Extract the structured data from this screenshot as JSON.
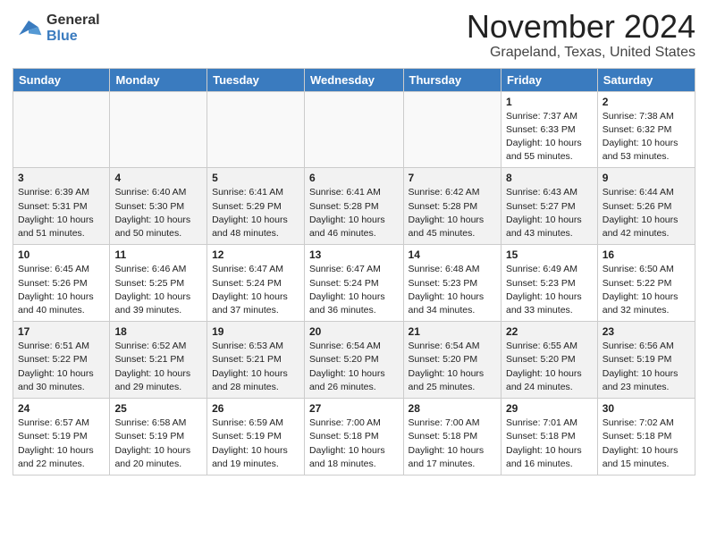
{
  "logo": {
    "general": "General",
    "blue": "Blue"
  },
  "title": "November 2024",
  "location": "Grapeland, Texas, United States",
  "weekdays": [
    "Sunday",
    "Monday",
    "Tuesday",
    "Wednesday",
    "Thursday",
    "Friday",
    "Saturday"
  ],
  "weeks": [
    [
      {
        "day": "",
        "info": ""
      },
      {
        "day": "",
        "info": ""
      },
      {
        "day": "",
        "info": ""
      },
      {
        "day": "",
        "info": ""
      },
      {
        "day": "",
        "info": ""
      },
      {
        "day": "1",
        "info": "Sunrise: 7:37 AM\nSunset: 6:33 PM\nDaylight: 10 hours\nand 55 minutes."
      },
      {
        "day": "2",
        "info": "Sunrise: 7:38 AM\nSunset: 6:32 PM\nDaylight: 10 hours\nand 53 minutes."
      }
    ],
    [
      {
        "day": "3",
        "info": "Sunrise: 6:39 AM\nSunset: 5:31 PM\nDaylight: 10 hours\nand 51 minutes."
      },
      {
        "day": "4",
        "info": "Sunrise: 6:40 AM\nSunset: 5:30 PM\nDaylight: 10 hours\nand 50 minutes."
      },
      {
        "day": "5",
        "info": "Sunrise: 6:41 AM\nSunset: 5:29 PM\nDaylight: 10 hours\nand 48 minutes."
      },
      {
        "day": "6",
        "info": "Sunrise: 6:41 AM\nSunset: 5:28 PM\nDaylight: 10 hours\nand 46 minutes."
      },
      {
        "day": "7",
        "info": "Sunrise: 6:42 AM\nSunset: 5:28 PM\nDaylight: 10 hours\nand 45 minutes."
      },
      {
        "day": "8",
        "info": "Sunrise: 6:43 AM\nSunset: 5:27 PM\nDaylight: 10 hours\nand 43 minutes."
      },
      {
        "day": "9",
        "info": "Sunrise: 6:44 AM\nSunset: 5:26 PM\nDaylight: 10 hours\nand 42 minutes."
      }
    ],
    [
      {
        "day": "10",
        "info": "Sunrise: 6:45 AM\nSunset: 5:26 PM\nDaylight: 10 hours\nand 40 minutes."
      },
      {
        "day": "11",
        "info": "Sunrise: 6:46 AM\nSunset: 5:25 PM\nDaylight: 10 hours\nand 39 minutes."
      },
      {
        "day": "12",
        "info": "Sunrise: 6:47 AM\nSunset: 5:24 PM\nDaylight: 10 hours\nand 37 minutes."
      },
      {
        "day": "13",
        "info": "Sunrise: 6:47 AM\nSunset: 5:24 PM\nDaylight: 10 hours\nand 36 minutes."
      },
      {
        "day": "14",
        "info": "Sunrise: 6:48 AM\nSunset: 5:23 PM\nDaylight: 10 hours\nand 34 minutes."
      },
      {
        "day": "15",
        "info": "Sunrise: 6:49 AM\nSunset: 5:23 PM\nDaylight: 10 hours\nand 33 minutes."
      },
      {
        "day": "16",
        "info": "Sunrise: 6:50 AM\nSunset: 5:22 PM\nDaylight: 10 hours\nand 32 minutes."
      }
    ],
    [
      {
        "day": "17",
        "info": "Sunrise: 6:51 AM\nSunset: 5:22 PM\nDaylight: 10 hours\nand 30 minutes."
      },
      {
        "day": "18",
        "info": "Sunrise: 6:52 AM\nSunset: 5:21 PM\nDaylight: 10 hours\nand 29 minutes."
      },
      {
        "day": "19",
        "info": "Sunrise: 6:53 AM\nSunset: 5:21 PM\nDaylight: 10 hours\nand 28 minutes."
      },
      {
        "day": "20",
        "info": "Sunrise: 6:54 AM\nSunset: 5:20 PM\nDaylight: 10 hours\nand 26 minutes."
      },
      {
        "day": "21",
        "info": "Sunrise: 6:54 AM\nSunset: 5:20 PM\nDaylight: 10 hours\nand 25 minutes."
      },
      {
        "day": "22",
        "info": "Sunrise: 6:55 AM\nSunset: 5:20 PM\nDaylight: 10 hours\nand 24 minutes."
      },
      {
        "day": "23",
        "info": "Sunrise: 6:56 AM\nSunset: 5:19 PM\nDaylight: 10 hours\nand 23 minutes."
      }
    ],
    [
      {
        "day": "24",
        "info": "Sunrise: 6:57 AM\nSunset: 5:19 PM\nDaylight: 10 hours\nand 22 minutes."
      },
      {
        "day": "25",
        "info": "Sunrise: 6:58 AM\nSunset: 5:19 PM\nDaylight: 10 hours\nand 20 minutes."
      },
      {
        "day": "26",
        "info": "Sunrise: 6:59 AM\nSunset: 5:19 PM\nDaylight: 10 hours\nand 19 minutes."
      },
      {
        "day": "27",
        "info": "Sunrise: 7:00 AM\nSunset: 5:18 PM\nDaylight: 10 hours\nand 18 minutes."
      },
      {
        "day": "28",
        "info": "Sunrise: 7:00 AM\nSunset: 5:18 PM\nDaylight: 10 hours\nand 17 minutes."
      },
      {
        "day": "29",
        "info": "Sunrise: 7:01 AM\nSunset: 5:18 PM\nDaylight: 10 hours\nand 16 minutes."
      },
      {
        "day": "30",
        "info": "Sunrise: 7:02 AM\nSunset: 5:18 PM\nDaylight: 10 hours\nand 15 minutes."
      }
    ]
  ]
}
